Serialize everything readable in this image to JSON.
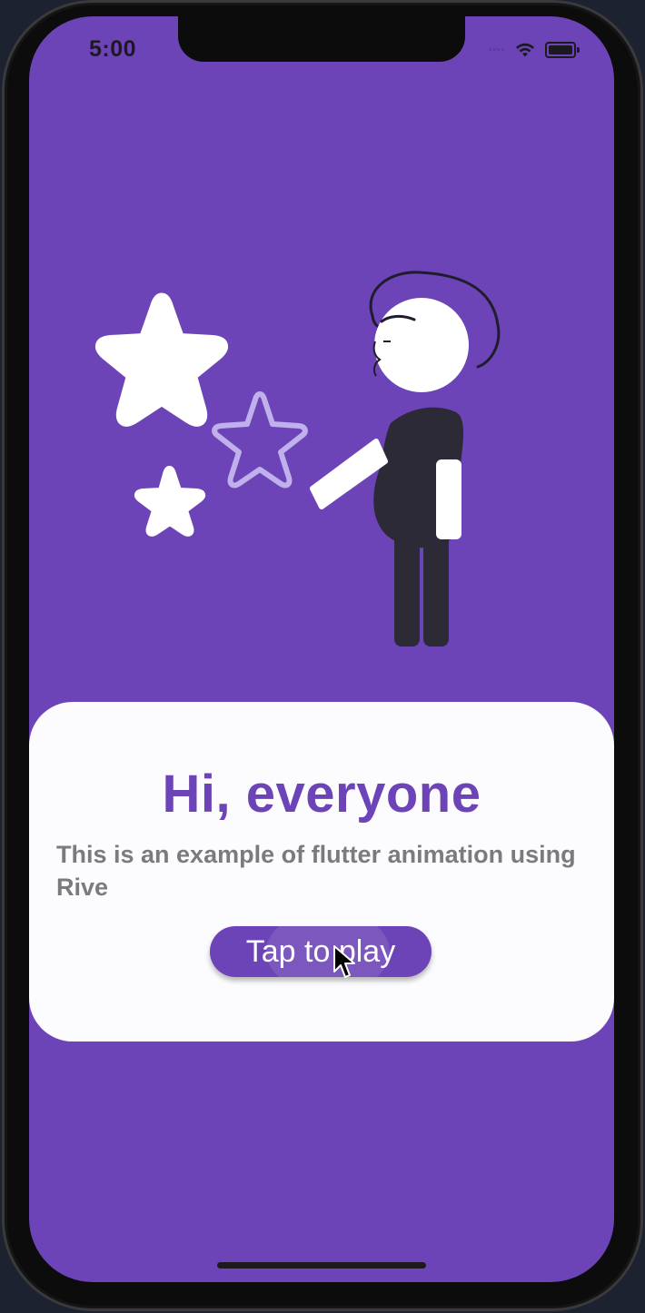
{
  "status_bar": {
    "time": "5:00",
    "signal_icon": "signal-dots-icon",
    "wifi_icon": "wifi-icon",
    "battery_icon": "battery-icon"
  },
  "illustration": {
    "description_icons": [
      "star-icon",
      "star-outline-icon",
      "character-figure"
    ]
  },
  "card": {
    "title": "Hi, everyone",
    "subtitle": "This is an example of flutter animation using Rive",
    "button_label": "Tap to play"
  },
  "colors": {
    "background": "#6d44b7",
    "card": "#fcfbfd",
    "title": "#6d44b7",
    "subtitle": "#7b7b7e",
    "button": "#6d44b7",
    "button_text": "#ffffff"
  }
}
